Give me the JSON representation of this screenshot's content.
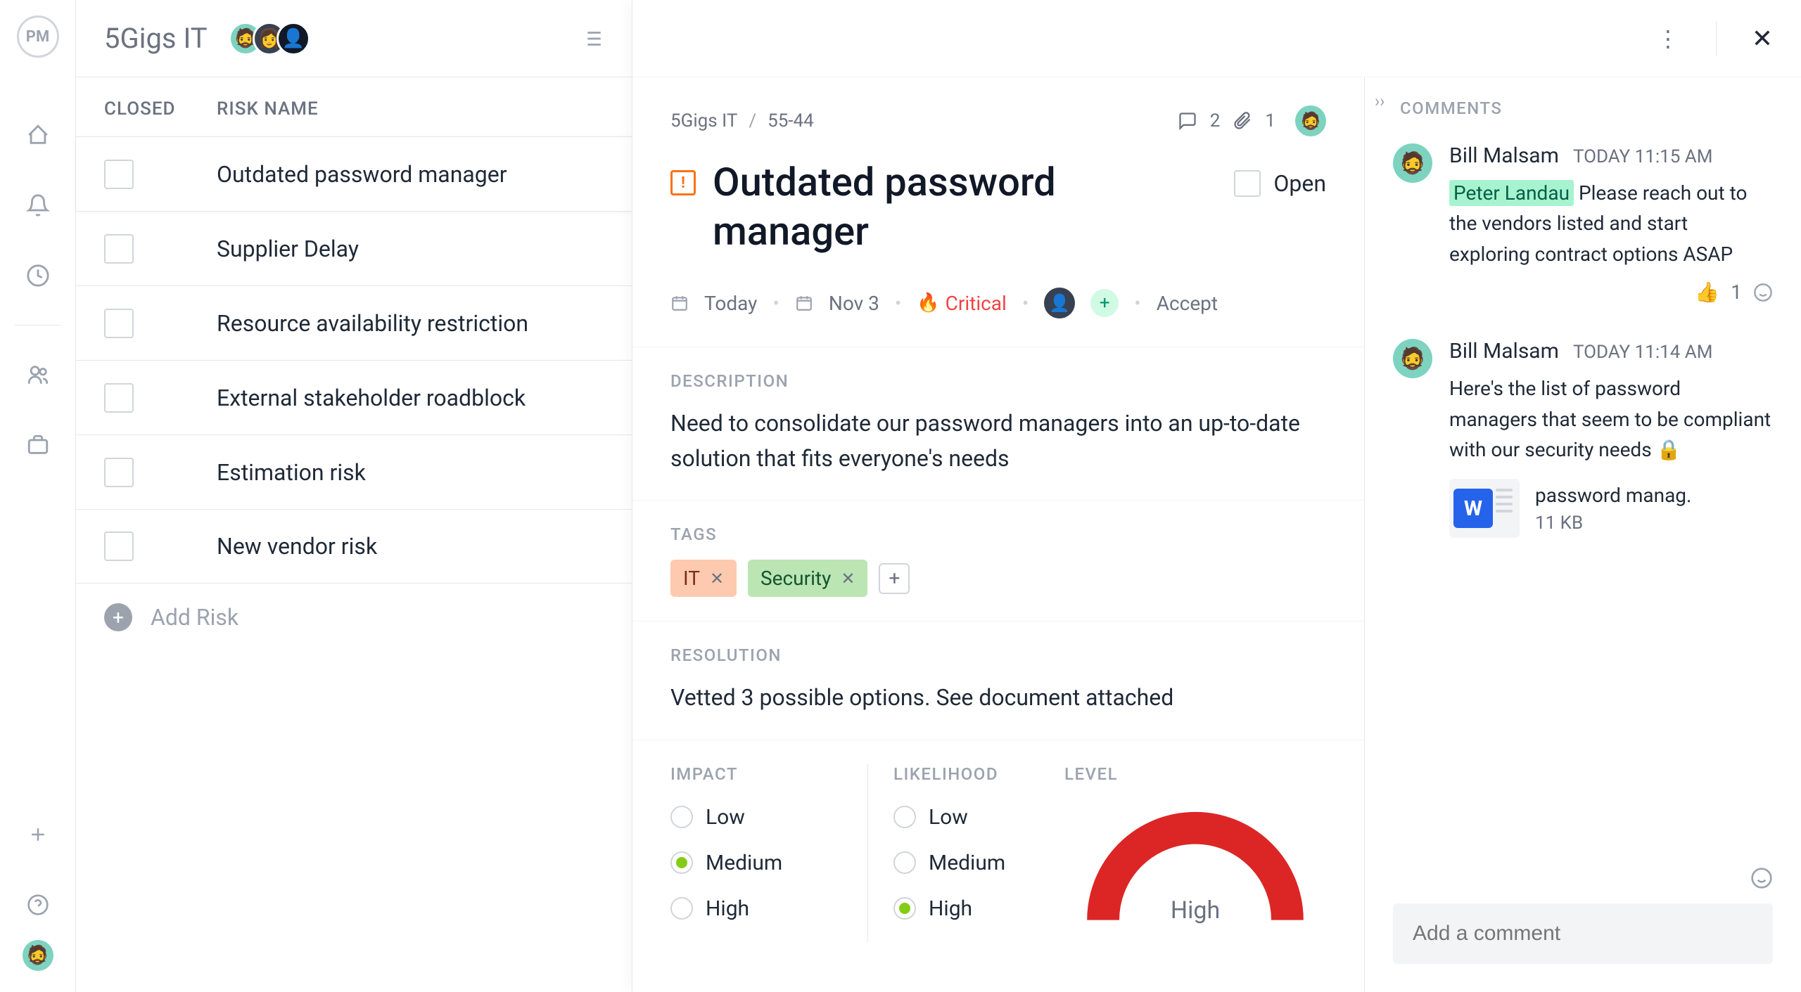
{
  "project": {
    "name": "5Gigs IT"
  },
  "columns": {
    "closed": "CLOSED",
    "riskName": "RISK NAME"
  },
  "risks": [
    {
      "name": "Outdated password manager",
      "selected": true
    },
    {
      "name": "Supplier Delay"
    },
    {
      "name": "Resource availability restriction"
    },
    {
      "name": "External stakeholder roadblock"
    },
    {
      "name": "Estimation risk"
    },
    {
      "name": "New vendor risk"
    }
  ],
  "addRiskLabel": "Add Risk",
  "detail": {
    "breadcrumb": {
      "project": "5Gigs IT",
      "id": "55-44"
    },
    "title": "Outdated password manager",
    "status": "Open",
    "commentCount": "2",
    "attachmentCount": "1",
    "created": "Today",
    "due": "Nov 3",
    "priorityLabel": "Critical",
    "responseLabel": "Accept",
    "description": {
      "label": "DESCRIPTION",
      "text": "Need to consolidate our password managers into an up-to-date solution that fits everyone's needs"
    },
    "tags": {
      "label": "TAGS",
      "items": [
        {
          "name": "IT",
          "cls": "it"
        },
        {
          "name": "Security",
          "cls": "sec"
        }
      ]
    },
    "resolution": {
      "label": "RESOLUTION",
      "text": "Vetted 3 possible options. See document attached"
    },
    "impact": {
      "label": "IMPACT",
      "options": [
        "Low",
        "Medium",
        "High"
      ],
      "selected": "Medium"
    },
    "likelihood": {
      "label": "LIKELIHOOD",
      "options": [
        "Low",
        "Medium",
        "High"
      ],
      "selected": "High"
    },
    "level": {
      "label": "LEVEL",
      "value": "High"
    }
  },
  "comments": {
    "label": "COMMENTS",
    "items": [
      {
        "author": "Bill Malsam",
        "time": "TODAY 11:15 AM",
        "mention": "Peter Landau",
        "text": " Please reach out to the vendors listed and start exploring contract options ASAP",
        "reactions": {
          "emoji": "👍",
          "count": "1"
        }
      },
      {
        "author": "Bill Malsam",
        "time": "TODAY 11:14 AM",
        "text": "Here's the list of password managers that seem to be compliant with our security needs 🔒",
        "attachment": {
          "name": "password manag.",
          "size": "11 KB"
        }
      }
    ],
    "placeholder": "Add a comment"
  }
}
